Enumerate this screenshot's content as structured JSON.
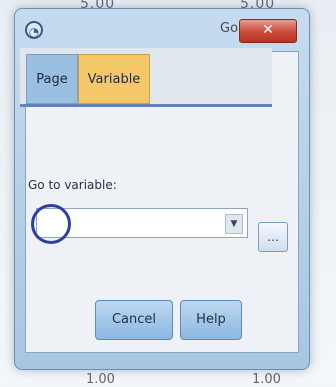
{
  "window": {
    "title": "Go To",
    "close_label": "✕"
  },
  "tabs": [
    {
      "label": "Page"
    },
    {
      "label": "Variable"
    }
  ],
  "form": {
    "field_label": "Go to variable:",
    "combo_value": "",
    "browse_label": "…"
  },
  "buttons": {
    "cancel": "Cancel",
    "help": "Help"
  },
  "background": {
    "top_left": "5.00",
    "top_right": "5.00",
    "bottom_left": "1.00",
    "bottom_right": "1.00"
  },
  "colors": {
    "tab_page": "#9bbfe0",
    "tab_variable": "#f4c869",
    "accent": "#5d86b4"
  }
}
